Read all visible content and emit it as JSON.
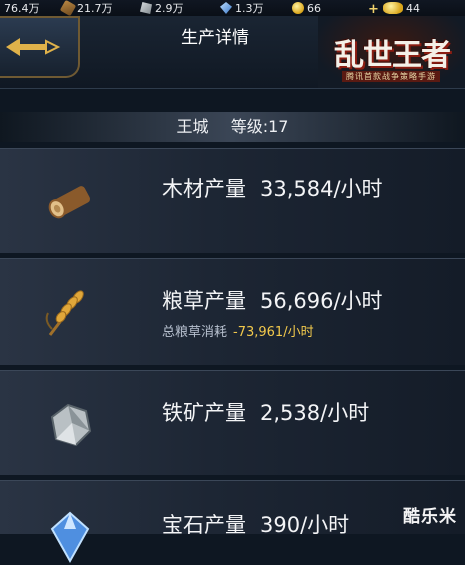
{
  "resources": [
    {
      "icon": "food-icon",
      "value": "76.4万"
    },
    {
      "icon": "wood-icon",
      "value": "21.7万"
    },
    {
      "icon": "iron-icon",
      "value": "2.9万"
    },
    {
      "icon": "gem-icon",
      "value": "1.3万"
    },
    {
      "icon": "coin-icon",
      "value": "66"
    },
    {
      "icon": "gold-ingot-icon",
      "value": "44"
    }
  ],
  "header": {
    "title": "生产详情"
  },
  "logo": {
    "title": "乱世王者",
    "subtitle": "腾讯首款战争策略手游"
  },
  "city": {
    "name": "王城",
    "level_label": "等级:17"
  },
  "rows": [
    {
      "icon": "wood-log-icon",
      "label": "木材产量",
      "value": "33,584/小时"
    },
    {
      "icon": "grain-icon",
      "label": "粮草产量",
      "value": "56,696/小时",
      "consume_label": "总粮草消耗",
      "consume_value": "-73,961/小时"
    },
    {
      "icon": "iron-ore-icon",
      "label": "铁矿产量",
      "value": "2,538/小时"
    },
    {
      "icon": "gem-icon",
      "label": "宝石产量",
      "value": "390/小时"
    }
  ],
  "watermark": "酷乐米",
  "colors": {
    "consume": "#f2c94c",
    "panel": "#1d2634",
    "gold_border": "#6f5a33"
  }
}
